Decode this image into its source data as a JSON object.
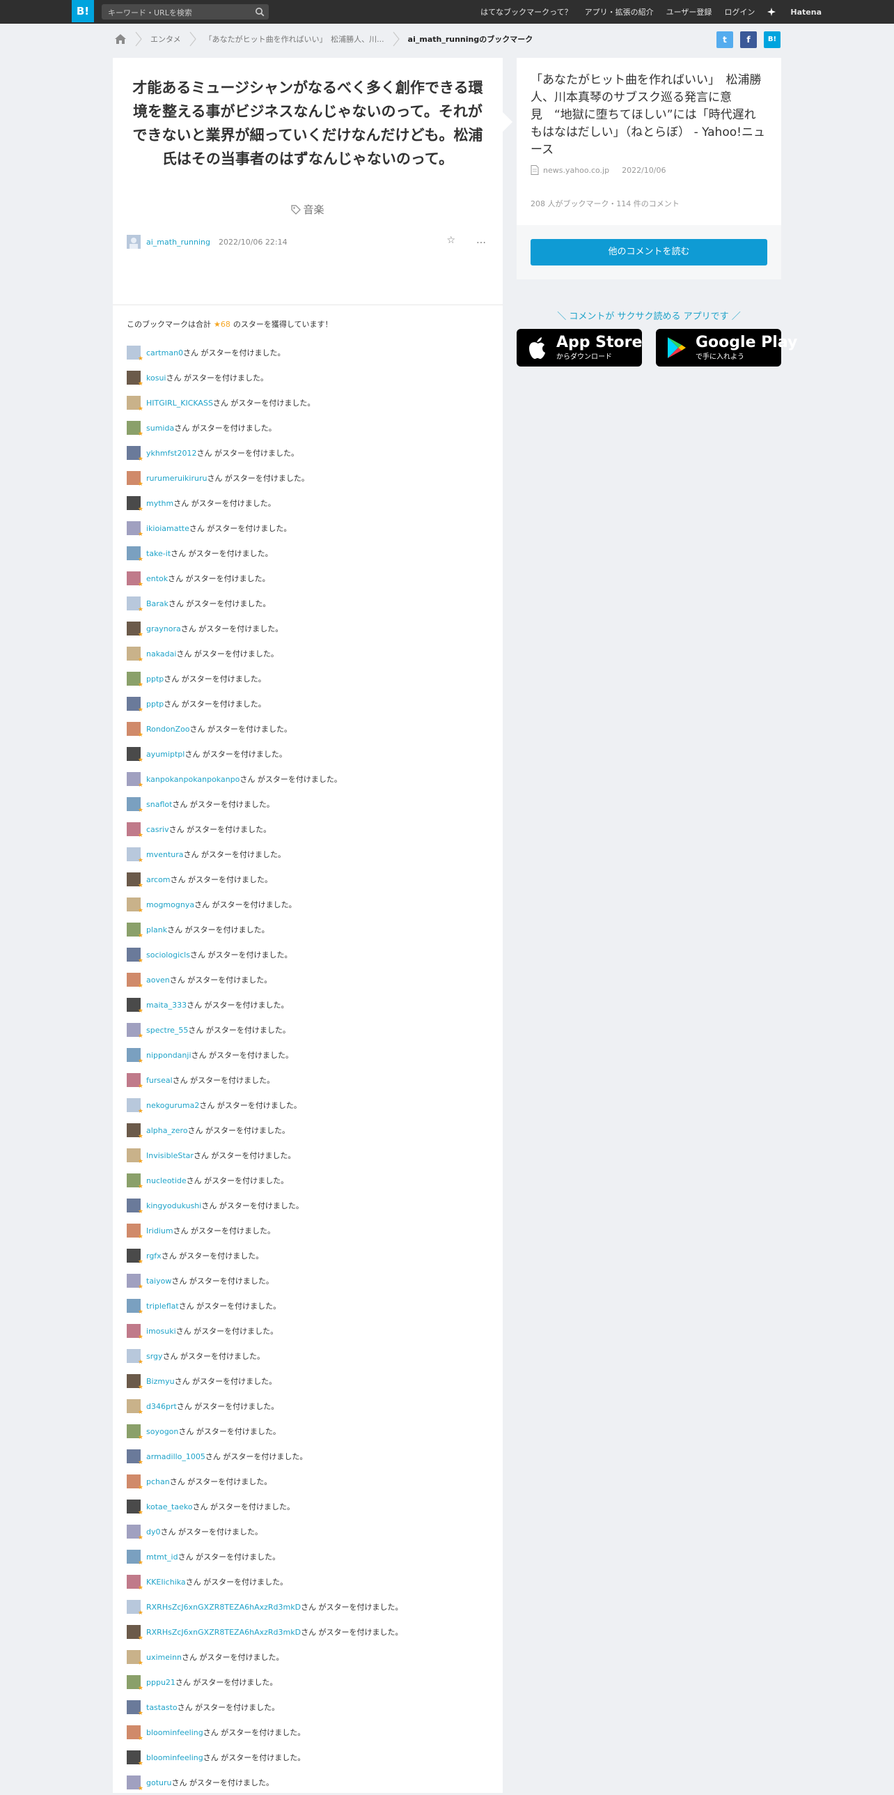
{
  "header": {
    "logo": "B!",
    "search_placeholder": "キーワード・URLを検索",
    "nav": [
      "はてなブックマークって？",
      "アプリ・拡張の紹介",
      "ユーザー登録",
      "ログイン"
    ],
    "brand": "Hatena"
  },
  "breadcrumb": {
    "items": [
      "エンタメ",
      "「あなたがヒット曲を作ればいい」　松浦勝人、川..."
    ],
    "current": "ai_math_runningのブックマーク"
  },
  "share": {
    "twitter": "t",
    "facebook": "f",
    "hatena": "B!"
  },
  "bookmark": {
    "comment": "才能あるミュージシャンがなるべく多く創作できる環境を整える事がビジネスなんじゃないのって。それができないと業界が細っていくだけなんだけども。松浦氏はその当事者のはずなんじゃないのって。",
    "tag": "音楽",
    "user": "ai_math_running",
    "date": "2022/10/06 22:14",
    "star_action": "☆",
    "more_action": "…"
  },
  "stars": {
    "summary_before": "このブックマークは合計",
    "count": "★68",
    "summary_after": "のスターを獲得しています！",
    "suffix": "さん がスターを付けました。",
    "users": [
      "cartman0",
      "kosui",
      "HITGIRL_KICKASS",
      "sumida",
      "ykhmfst2012",
      "rurumeruikiruru",
      "mythm",
      "ikioiamatte",
      "take-it",
      "entok",
      "Barak",
      "graynora",
      "nakadai",
      "pptp",
      "pptp",
      "RondonZoo",
      "ayumiptpl",
      "kanpokanpokanpokanpo",
      "snaflot",
      "casriv",
      "mventura",
      "arcom",
      "mogmognya",
      "plank",
      "sociologicls",
      "aoven",
      "maita_333",
      "spectre_55",
      "nippondanji",
      "furseal",
      "nekoguruma2",
      "alpha_zero",
      "InvisibleStar",
      "nucleotide",
      "kingyodukushi",
      "Iridium",
      "rgfx",
      "taiyow",
      "tripleflat",
      "imosuki",
      "srgy",
      "Bizmyu",
      "d346prt",
      "soyogon",
      "armadillo_1005",
      "pchan",
      "kotae_taeko",
      "dy0",
      "mtmt_id",
      "KKEIichika",
      "RXRHsZcJ6xnGXZR8TEZA6hAxzRd3mkD",
      "RXRHsZcJ6xnGXZR8TEZA6hAxzRd3mkD",
      "uximeinn",
      "pppu21",
      "tastasto",
      "bloominfeeling",
      "bloominfeeling",
      "goturu"
    ]
  },
  "entry": {
    "title": "「あなたがヒット曲を作ればいい」　松浦勝人、川本真琴のサブスク巡る発言に意見　“地獄に堕ちてほしい”には「時代遅れもはなはだしい」（ねとらぼ） - Yahoo!ニュース",
    "domain": "news.yahoo.co.jp",
    "date": "2022/10/06",
    "counts": "208 人がブックマーク・114 件のコメント",
    "read_button": "他のコメントを読む"
  },
  "promo": {
    "text": "＼ コメントが サクサク読める アプリです ／",
    "appstore_big": "App Store",
    "appstore_small": "からダウンロード",
    "googleplay_big": "Google Play",
    "googleplay_small": "で手に入れよう"
  },
  "colors": {
    "accent": "#00a4de",
    "link": "#1fa3c9",
    "star": "#f5a623",
    "twitter": "#55acee",
    "facebook": "#3b5998"
  }
}
